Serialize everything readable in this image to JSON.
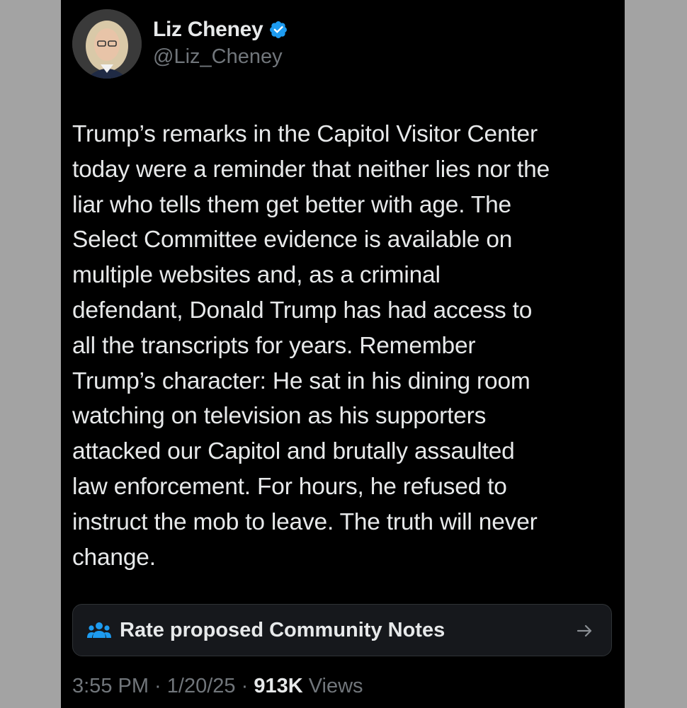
{
  "author": {
    "name": "Liz Cheney",
    "handle": "@Liz_Cheney",
    "verified": true,
    "verified_icon": "verified-badge-icon"
  },
  "tweet": {
    "text": "Trump’s remarks in the Capitol Visitor Center\ntoday were a reminder that neither lies nor the\nliar who tells them get better with age. The\nSelect Committee evidence is available on\nmultiple websites and, as a criminal\ndefendant, Donald Trump has had access to\nall the transcripts for years. Remember\nTrump’s character: He sat in his dining room\nwatching on television as his supporters\nattacked our Capitol and brutally assaulted\nlaw enforcement. For hours, he refused to\ninstruct the mob to leave. The truth will never\nchange."
  },
  "community_notes": {
    "label": "Rate proposed Community Notes",
    "icon": "people-icon",
    "arrow_icon": "arrow-right-icon"
  },
  "meta": {
    "time": "3:55 PM",
    "separator1": " · ",
    "date": "1/20/25",
    "separator2": " · ",
    "views_count": "913K",
    "views_label": " Views"
  },
  "colors": {
    "background": "#000000",
    "text": "#e7e9ea",
    "secondary_text": "#71767b",
    "verified_blue": "#1d9bf0",
    "outer_background": "#a3a3a3"
  }
}
